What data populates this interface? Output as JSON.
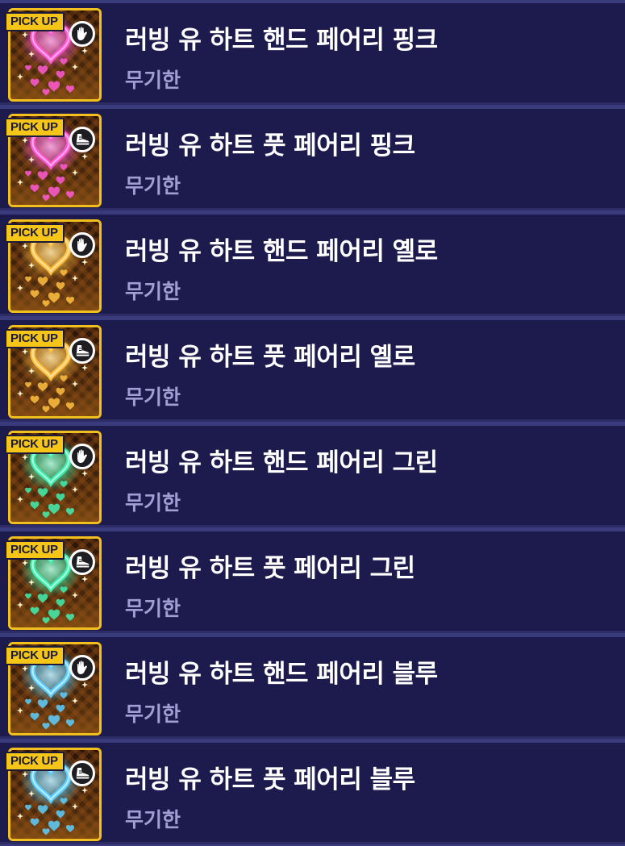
{
  "badge_text": "PICK UP",
  "items": [
    {
      "name": "러빙 유 하트 핸드 페어리 핑크",
      "duration": "무기한",
      "type_icon": "hand-icon",
      "effect_color": "#ff59d6",
      "effect_glow": "#ffb3ef"
    },
    {
      "name": "러빙 유 하트 풋 페어리 핑크",
      "duration": "무기한",
      "type_icon": "shoe-icon",
      "effect_color": "#ff59d6",
      "effect_glow": "#ffb3ef"
    },
    {
      "name": "러빙 유 하트 핸드 페어리 옐로",
      "duration": "무기한",
      "type_icon": "hand-icon",
      "effect_color": "#ffc040",
      "effect_glow": "#ffe6a8"
    },
    {
      "name": "러빙 유 하트 풋 페어리 옐로",
      "duration": "무기한",
      "type_icon": "shoe-icon",
      "effect_color": "#ffc040",
      "effect_glow": "#ffe6a8"
    },
    {
      "name": "러빙 유 하트 핸드 페어리 그린",
      "duration": "무기한",
      "type_icon": "hand-icon",
      "effect_color": "#3ff0b0",
      "effect_glow": "#b5ffe4"
    },
    {
      "name": "러빙 유 하트 풋 페어리 그린",
      "duration": "무기한",
      "type_icon": "shoe-icon",
      "effect_color": "#3ff0b0",
      "effect_glow": "#b5ffe4"
    },
    {
      "name": "러빙 유 하트 핸드 페어리 블루",
      "duration": "무기한",
      "type_icon": "hand-icon",
      "effect_color": "#5ccfff",
      "effect_glow": "#c2efff"
    },
    {
      "name": "러빙 유 하트 풋 페어리 블루",
      "duration": "무기한",
      "type_icon": "shoe-icon",
      "effect_color": "#5ccfff",
      "effect_glow": "#c2efff"
    }
  ]
}
